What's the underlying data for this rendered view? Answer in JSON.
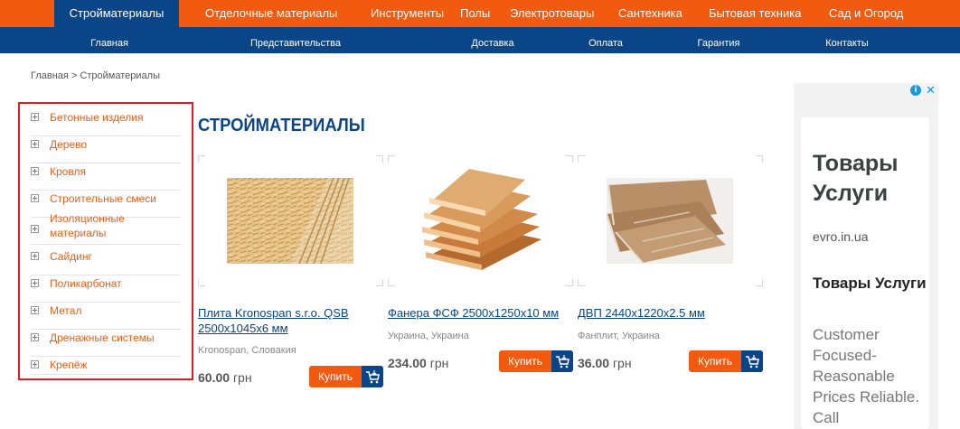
{
  "top_nav": {
    "items": [
      "Стройматериалы",
      "Отделочные материалы",
      "Инструменты",
      "Полы",
      "Электротовары",
      "Сантехника",
      "Бытовая техника",
      "Сад и Огород"
    ],
    "active": "Стройматериалы"
  },
  "sub_nav": {
    "items": [
      "Главная",
      "Представительства",
      "Доставка",
      "Оплата",
      "Гарантия",
      "Контакты"
    ]
  },
  "breadcrumb": {
    "home": "Главная",
    "separator": ">",
    "current": "Стройматериалы"
  },
  "sidebar": {
    "categories": [
      "Бетонные изделия",
      "Дерево",
      "Кровля",
      "Строительные смеси",
      "Изоляционные материалы",
      "Сайдинг",
      "Поликарбонат",
      "Метал",
      "Дренажные системы",
      "Крепёж"
    ]
  },
  "main": {
    "title": "СТРОЙМАТЕРИАЛЫ"
  },
  "products": [
    {
      "name": "Плита Kronospan s.r.o. QSB 2500x1045x6 мм",
      "origin": "Kronospan, Словакия",
      "price": "60.00",
      "currency": "грн",
      "buy_label": "Купить",
      "image": "osb-board"
    },
    {
      "name": "Фанера ФСФ 2500x1250x10 мм",
      "origin": "Украина, Украина",
      "price": "234.00",
      "currency": "грн",
      "buy_label": "Купить",
      "image": "plywood-stack"
    },
    {
      "name": "ДВП 2440x1220x2.5 мм",
      "origin": "Фанплит, Украина",
      "price": "36.00",
      "currency": "грн",
      "buy_label": "Купить",
      "image": "hardboard-stack"
    }
  ],
  "ad": {
    "headline": "Товары Услуги",
    "url": "evro.in.ua",
    "subheadline": "Товары Услуги",
    "body": "Customer Focused- Reasonable Prices Reliable. Call",
    "info_icon": "info-icon",
    "close_icon": "close-icon"
  },
  "colors": {
    "orange": "#f15a0f",
    "navy": "#0a4587",
    "link_orange": "#e9601a",
    "highlight_red": "#e8191f"
  }
}
